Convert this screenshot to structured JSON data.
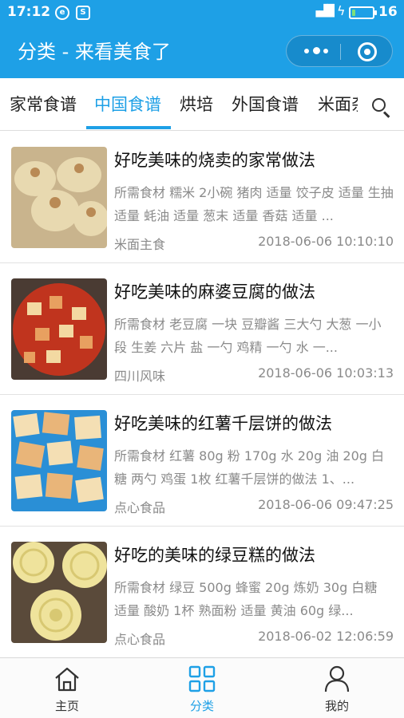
{
  "status_bar": {
    "time": "17:12",
    "app_icon_1": "weibo-icon",
    "app_icon_2": "s-app-icon",
    "signal_label": "4G",
    "battery_level": 16,
    "battery_text": "16"
  },
  "nav": {
    "title": "分类 - 来看美食了",
    "menu_icon": "more-dots-icon",
    "close_icon": "target-circle-icon"
  },
  "tabs": [
    {
      "label": "家常食谱",
      "active": false
    },
    {
      "label": "中国食谱",
      "active": true
    },
    {
      "label": "烘培",
      "active": false
    },
    {
      "label": "外国食谱",
      "active": false
    },
    {
      "label": "米面杂",
      "active": false
    }
  ],
  "recipes": [
    {
      "title": "好吃美味的烧卖的家常做法",
      "ingredients": "所需食材 糯米 2小碗 猪肉 适量 饺子皮 适量 生抽 适量 蚝油 适量 葱末 适量 香菇 适量 ...",
      "category": "米面主食",
      "date": "2018-06-06 10:10:10",
      "thumb_colors": [
        "#c9b48d",
        "#e8d9b0",
        "#b98a55"
      ]
    },
    {
      "title": "好吃美味的麻婆豆腐的做法",
      "ingredients": "所需食材 老豆腐 一块 豆瓣酱 三大勺 大葱 一小段 生姜 六片 盐 一勺 鸡精 一勺 水 一...",
      "category": "四川风味",
      "date": "2018-06-06 10:03:13",
      "thumb_colors": [
        "#c0341e",
        "#e8a060",
        "#f3d9a2"
      ]
    },
    {
      "title": "好吃美味的红薯千层饼的做法",
      "ingredients": "所需食材 红薯 80g 粉 170g 水 20g 油 20g 白糖 两勺 鸡蛋 1枚 红薯千层饼的做法 1、...",
      "category": "点心食品",
      "date": "2018-06-06 09:47:25",
      "thumb_colors": [
        "#2a8fd6",
        "#f4dfb4",
        "#e9b579"
      ]
    },
    {
      "title": "好吃的美味的绿豆糕的做法",
      "ingredients": "所需食材 绿豆 500g 蜂蜜 20g 炼奶 30g 白糖 适量 酸奶 1杯 熟面粉 适量 黄油 60g 绿...",
      "category": "点心食品",
      "date": "2018-06-02 12:06:59",
      "thumb_colors": [
        "#5a4a3a",
        "#efe39c",
        "#d8c872"
      ]
    }
  ],
  "tabbar": [
    {
      "label": "主页",
      "icon": "home-icon",
      "active": false
    },
    {
      "label": "分类",
      "icon": "grid-icon",
      "active": true
    },
    {
      "label": "我的",
      "icon": "person-icon",
      "active": false
    }
  ],
  "colors": {
    "accent": "#1ea0e6",
    "text_secondary": "#8a8a8a"
  }
}
